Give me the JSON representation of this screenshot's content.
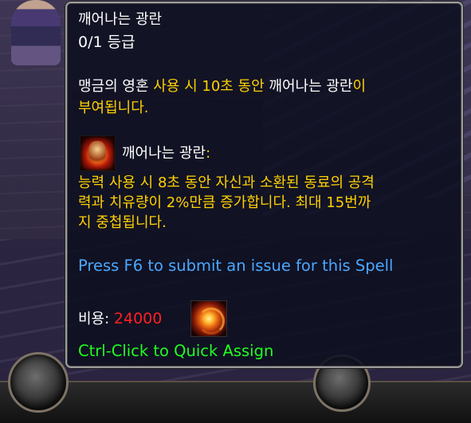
{
  "tooltip": {
    "title": "깨어나는 광란",
    "rank": "0/1 등급",
    "description": {
      "part1": "맹금의 영혼 ",
      "part2": "사용 시 10초 동안",
      "part3": " 깨어나는 광란",
      "part4": "이",
      "line2": "부여됩니다."
    },
    "buff": {
      "name": "깨어나는 광란",
      "colon": ":",
      "icon": "frenzy-buff-icon",
      "lines": [
        "능력 사용 시 8초 동안 자신과 소환된 동료의 공격",
        "력과 치유량이 2%만큼 증가합니다. 최대 15번까",
        "지 중첩됩니다."
      ]
    },
    "issue_hint": "Press F6 to submit an issue for this Spell",
    "cost": {
      "label": "비용: ",
      "value": "24000",
      "icon": "spell-orb-icon"
    },
    "quick_assign": "Ctrl-Click to Quick Assign"
  },
  "colors": {
    "gold": "#ffd100",
    "blue": "#4aa8ff",
    "red": "#ff2020",
    "green": "#20ff20",
    "white": "#ffffff"
  }
}
